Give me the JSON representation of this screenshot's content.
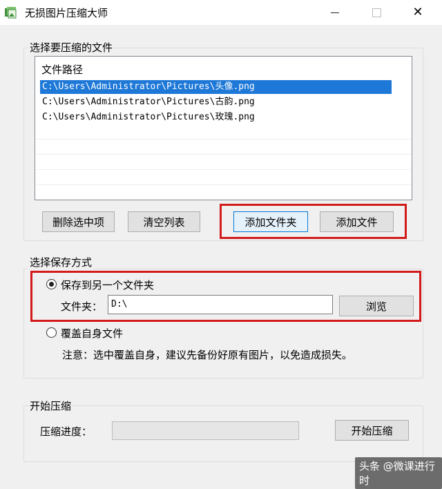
{
  "window": {
    "title": "无损图片压缩大师",
    "minimize_icon": "minimize-icon",
    "maximize_icon": "maximize-icon",
    "close_icon": "close-icon"
  },
  "file_section": {
    "label": "选择要压缩的文件",
    "list_header": "文件路径",
    "files": [
      "C:\\Users\\Administrator\\Pictures\\头像.png",
      "C:\\Users\\Administrator\\Pictures\\古韵.png",
      "C:\\Users\\Administrator\\Pictures\\玫瑰.png"
    ],
    "selected_index": 0,
    "buttons": {
      "delete_selected": "删除选中项",
      "clear_list": "清空列表",
      "add_folder": "添加文件夹",
      "add_file": "添加文件"
    }
  },
  "save_section": {
    "label": "选择保存方式",
    "option_other_folder": "保存到另一个文件夹",
    "folder_label": "文件夹：",
    "folder_value": "D:\\",
    "browse_button": "浏览",
    "option_overwrite": "覆盖自身文件",
    "note": "注意：选中覆盖自身，建议先备份好原有图片，以免造成损失。",
    "selected_option": "other_folder"
  },
  "compress_section": {
    "label": "开始压缩",
    "progress_label": "压缩进度：",
    "progress_fraction": 0,
    "start_button": "开始压缩"
  },
  "watermark": "头条 @微课进行时",
  "colors": {
    "selection": "#1e78d7",
    "highlight_box": "#d21a1a",
    "progress_fill": "#06b025"
  }
}
